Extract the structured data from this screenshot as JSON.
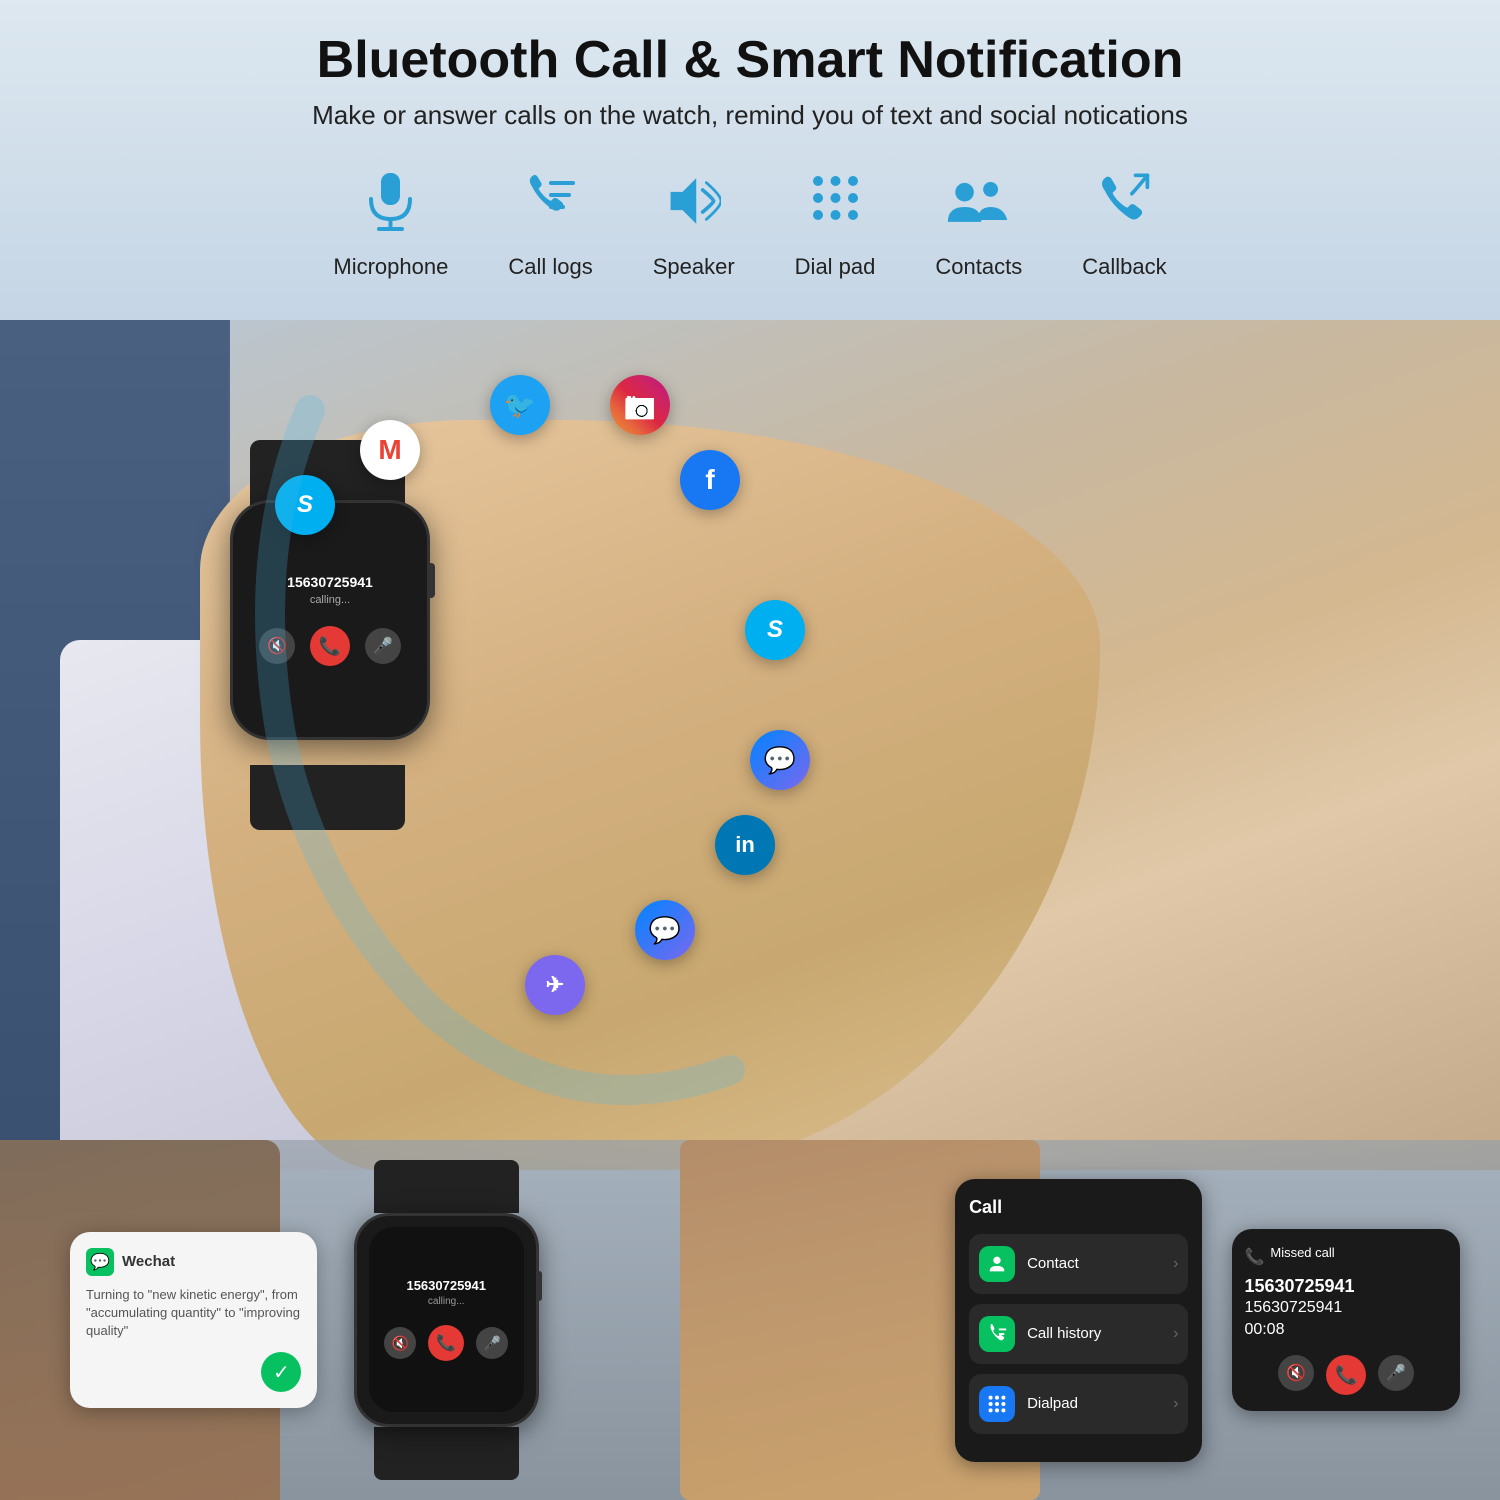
{
  "header": {
    "title": "Bluetooth Call & Smart Notification",
    "subtitle": "Make or answer calls on the watch, remind you of text and social notications"
  },
  "features": [
    {
      "id": "microphone",
      "label": "Microphone",
      "icon": "🎤"
    },
    {
      "id": "call-logs",
      "label": "Call logs",
      "icon": "📞"
    },
    {
      "id": "speaker",
      "label": "Speaker",
      "icon": "🔊"
    },
    {
      "id": "dial-pad",
      "label": "Dial pad",
      "icon": "⠿"
    },
    {
      "id": "contacts",
      "label": "Contacts",
      "icon": "👥"
    },
    {
      "id": "callback",
      "label": "Callback",
      "icon": "📲"
    }
  ],
  "watch_main": {
    "number": "15630725941",
    "status": "calling..."
  },
  "social_icons": [
    {
      "id": "gmail",
      "label": "G",
      "char": "M"
    },
    {
      "id": "twitter",
      "label": "🐦"
    },
    {
      "id": "instagram",
      "label": "📷"
    },
    {
      "id": "skype",
      "label": "S"
    },
    {
      "id": "facebook",
      "label": "f"
    },
    {
      "id": "messenger",
      "label": "m"
    },
    {
      "id": "linkedin",
      "label": "in"
    },
    {
      "id": "telegram",
      "label": "✈"
    }
  ],
  "bottom": {
    "wechat": {
      "title": "Wechat",
      "text": "Turning to \"new kinetic energy\", from \"accumulating quantity\" to \"improving quality\""
    },
    "watch_small": {
      "number": "15630725941",
      "status": "calling..."
    },
    "call_menu": {
      "title": "Call",
      "items": [
        {
          "label": "Contact",
          "icon": "👤",
          "type": "contact"
        },
        {
          "label": "Call history",
          "icon": "📋",
          "type": "history"
        },
        {
          "label": "Dialpad",
          "icon": "⠿",
          "type": "dialpad"
        }
      ]
    },
    "missed": {
      "header": "Missed call",
      "number1": "15630725941",
      "number2": "15630725941",
      "time": "00:08"
    }
  }
}
